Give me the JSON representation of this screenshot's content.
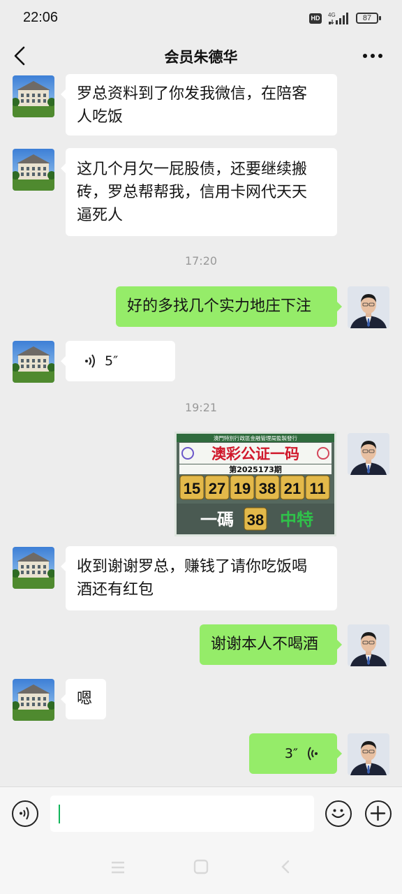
{
  "status_bar": {
    "time": "22:06",
    "hd": "HD",
    "network": "4G",
    "battery": "87"
  },
  "header": {
    "title": "会员朱德华",
    "back_icon": "back-arrow-icon",
    "more_icon": "more-dots-icon"
  },
  "messages": [
    {
      "side": "left",
      "type": "text",
      "text": [
        "罗总资料到了你发我微信，在陪客",
        "人吃饭"
      ]
    },
    {
      "side": "left",
      "type": "text",
      "text": [
        "这几个月欠一屁股债，还要继续搬",
        "砖，罗总帮帮我，信用卡网代天天",
        "逼死人"
      ]
    },
    {
      "type": "timestamp",
      "text": "17:20"
    },
    {
      "side": "right",
      "type": "text",
      "text": [
        "好的多找几个实力地庄下注"
      ]
    },
    {
      "side": "left",
      "type": "voice",
      "text": "5″"
    },
    {
      "type": "timestamp",
      "text": "19:21"
    },
    {
      "side": "right",
      "type": "image",
      "image": {
        "issuer": "澳門特別行政區金融管理局監製發行",
        "headline": "澳彩公证一码",
        "issue": "第2025173期",
        "numbers": [
          "15",
          "27",
          "19",
          "38",
          "21",
          "11"
        ],
        "footer_left": "一碼",
        "footer_number": "38",
        "footer_right": "中特"
      }
    },
    {
      "side": "left",
      "type": "text",
      "text": [
        "收到谢谢罗总，赚钱了请你吃饭喝",
        "酒还有红包"
      ]
    },
    {
      "side": "right",
      "type": "text",
      "text": [
        "谢谢本人不喝酒"
      ]
    },
    {
      "side": "left",
      "type": "text",
      "text": [
        "嗯"
      ]
    },
    {
      "side": "right",
      "type": "voice",
      "text": "3″"
    }
  ],
  "input_bar": {
    "value": "",
    "voice_icon": "voice-input-icon",
    "emoji_icon": "emoji-icon",
    "plus_icon": "plus-icon"
  },
  "system_nav": {
    "menu_icon": "menu-icon",
    "home_icon": "home-icon",
    "back_icon": "back-icon"
  },
  "colors": {
    "background": "#ededed",
    "bubble_me": "#95ec69",
    "bubble_other": "#ffffff",
    "accent": "#12b55b"
  }
}
